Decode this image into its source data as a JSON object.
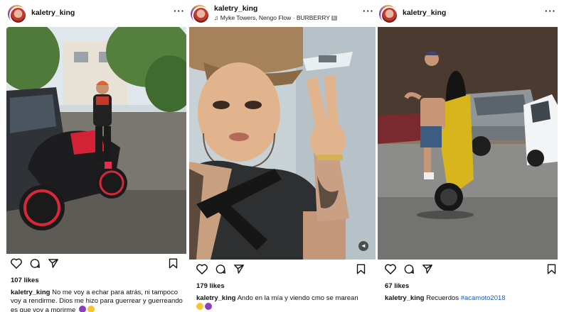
{
  "posts": [
    {
      "username": "kaletry_king",
      "likes": "107 likes",
      "caption_user": "kaletry_king",
      "caption_text": "No me voy a echar para atrás, ni tampoco voy a rendirme. Dios me hizo para guerrear y guerreando es que voy a morirme",
      "emojis": [
        "purple-devil",
        "pensive-face"
      ]
    },
    {
      "username": "kaletry_king",
      "song": "Myke Towers, Nengo Flow · BURBERRY",
      "explicit_badge": "E",
      "likes": "179 likes",
      "caption_user": "kaletry_king",
      "caption_text": "Ando en la mía y viendo cmo se marean",
      "emojis": [
        "pensive-face",
        "purple-devil"
      ]
    },
    {
      "username": "kaletry_king",
      "likes": "67 likes",
      "caption_user": "kaletry_king",
      "caption_text": "Recuerdos",
      "hashtag": "#acamoto2018"
    }
  ],
  "icons": [
    "heart-icon",
    "comment-icon",
    "share-icon",
    "bookmark-icon",
    "more-icon",
    "music-icon",
    "mute-icon"
  ]
}
